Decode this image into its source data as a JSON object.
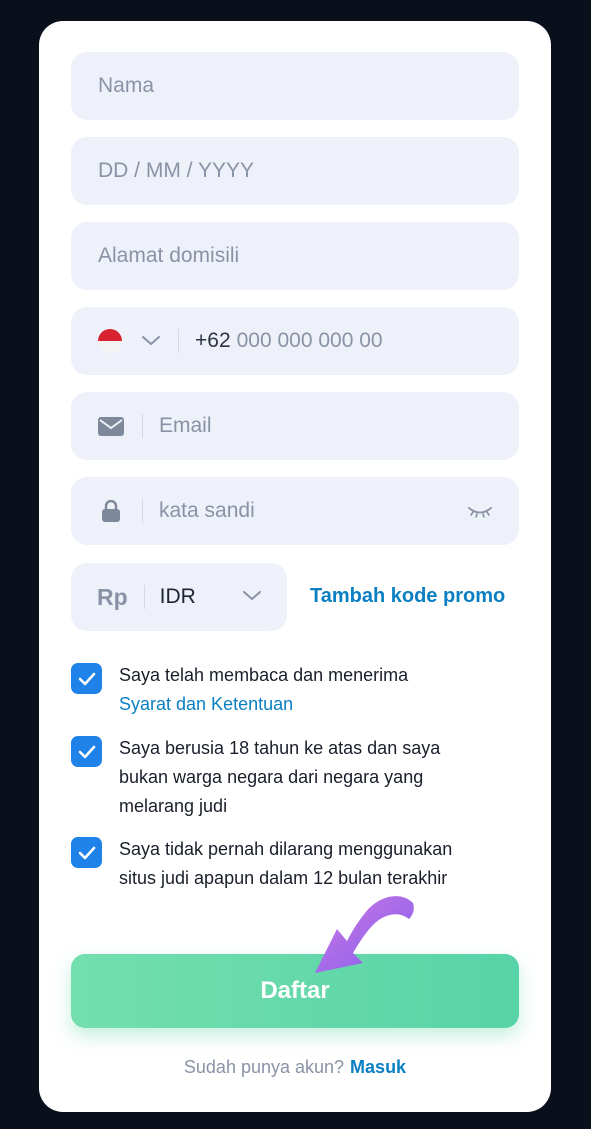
{
  "form": {
    "name_placeholder": "Nama",
    "dob_placeholder": "DD / MM / YYYY",
    "address_placeholder": "Alamat domisili",
    "phone": {
      "prefix": "+62",
      "placeholder": "000 000 000 00",
      "flag": "indonesia-flag"
    },
    "email_placeholder": "Email",
    "password_placeholder": "kata sandi",
    "currency": {
      "symbol": "Rp",
      "selected": "IDR"
    },
    "promo_link": "Tambah kode promo"
  },
  "checks": [
    {
      "text": "Saya telah membaca dan menerima",
      "link": "Syarat dan Ketentuan",
      "checked": true
    },
    {
      "text": "Saya berusia 18 tahun ke atas dan saya bukan warga negara dari negara yang melarang judi",
      "checked": true
    },
    {
      "text": "Saya tidak pernah dilarang menggunakan situs judi apapun dalam 12 bulan terakhir",
      "checked": true
    }
  ],
  "submit_label": "Daftar",
  "footer": {
    "question": "Sudah punya akun?",
    "login_link": "Masuk"
  },
  "colors": {
    "accent": "#0a7fc2",
    "checkbox": "#1e82e8",
    "button": "#5fd8aa",
    "arrow": "#a86ae8"
  }
}
